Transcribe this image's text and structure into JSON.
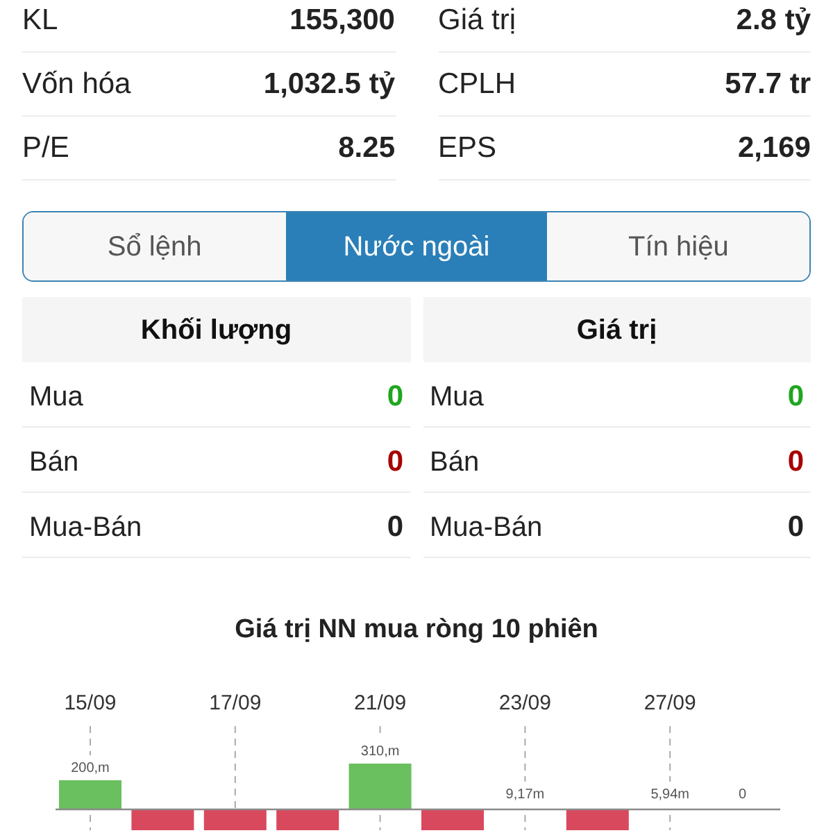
{
  "stats": {
    "left": [
      {
        "label": "KL",
        "value": "155,300"
      },
      {
        "label": "Vốn hóa",
        "value": "1,032.5 tỷ"
      },
      {
        "label": "P/E",
        "value": "8.25"
      }
    ],
    "right": [
      {
        "label": "Giá trị",
        "value": "2.8 tỷ"
      },
      {
        "label": "CPLH",
        "value": "57.7 tr"
      },
      {
        "label": "EPS",
        "value": "2,169"
      }
    ]
  },
  "tabs": [
    {
      "label": "Sổ lệnh",
      "selected": false
    },
    {
      "label": "Nước ngoài",
      "selected": true
    },
    {
      "label": "Tín hiệu",
      "selected": false
    }
  ],
  "foreign": [
    {
      "title": "Khối lượng",
      "rows": [
        {
          "kind": "buy",
          "label": "Mua",
          "value": "0"
        },
        {
          "kind": "sell",
          "label": "Bán",
          "value": "0"
        },
        {
          "kind": "net",
          "label": "Mua-Bán",
          "value": "0"
        }
      ]
    },
    {
      "title": "Giá trị",
      "rows": [
        {
          "kind": "buy",
          "label": "Mua",
          "value": "0"
        },
        {
          "kind": "sell",
          "label": "Bán",
          "value": "0"
        },
        {
          "kind": "net",
          "label": "Mua-Bán",
          "value": "0"
        }
      ]
    }
  ],
  "chart": {
    "title": "Giá trị NN mua ròng 10 phiên",
    "bars": [
      {
        "kind": "buy",
        "date": "15/09",
        "value_label": "200,m"
      },
      {
        "kind": "sell"
      },
      {
        "kind": "sell",
        "date": "17/09"
      },
      {
        "kind": "sell"
      },
      {
        "kind": "buy",
        "date": "21/09",
        "value_label": "310,m"
      },
      {
        "kind": "sell"
      },
      {
        "kind": "flat",
        "date": "23/09",
        "value_label": "9,17m"
      },
      {
        "kind": "sell"
      },
      {
        "kind": "flat",
        "date": "27/09",
        "value_label": "5,94m"
      },
      {
        "kind": "flat",
        "value_label": "0"
      }
    ]
  }
}
